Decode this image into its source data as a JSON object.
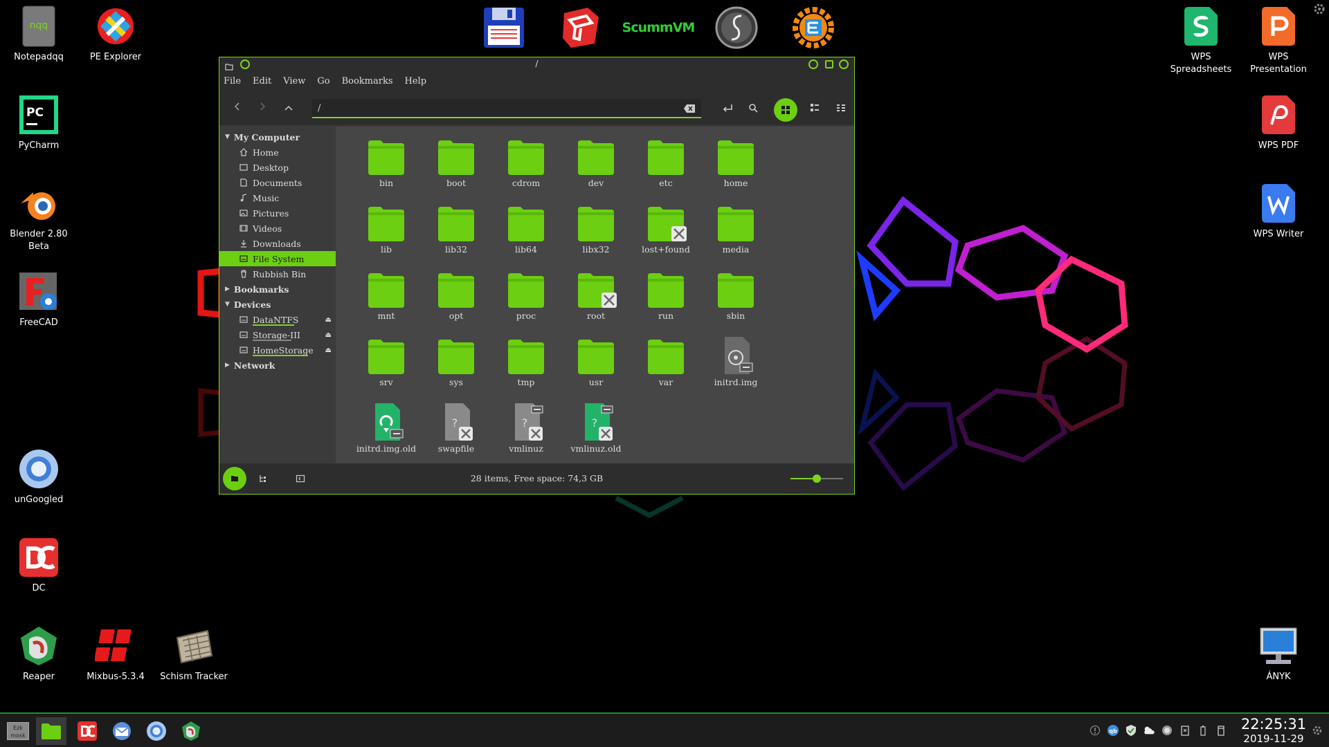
{
  "desktop": {
    "left_icons": [
      {
        "label": "Notepadqq"
      },
      {
        "label": "PE Explorer"
      },
      {
        "label": "PyCharm"
      },
      {
        "label": "Blender 2.80 Beta"
      },
      {
        "label": "FreeCAD"
      },
      {
        "label": "unGoogled"
      },
      {
        "label": "DC"
      },
      {
        "label": "Reaper"
      },
      {
        "label": "Mixbus-5.3.4"
      },
      {
        "label": "Schism Tracker"
      }
    ],
    "right_icons": [
      {
        "label": "WPS Spreadsheets"
      },
      {
        "label": "WPS Presentation"
      },
      {
        "label": "WPS PDF"
      },
      {
        "label": "WPS Writer"
      },
      {
        "label": "ÁNYK"
      }
    ],
    "top_dock": [
      {
        "name": "floppy-save-icon"
      },
      {
        "name": "sketchup-icon"
      },
      {
        "name": "scummvm-icon"
      },
      {
        "name": "script-s-icon"
      },
      {
        "name": "gear-e-icon"
      }
    ],
    "scummvm_text": "ScummVM",
    "notepadqq_badge": "nqq",
    "pycharm_badge": "PC"
  },
  "window": {
    "title": "/",
    "menu": [
      "File",
      "Edit",
      "View",
      "Go",
      "Bookmarks",
      "Help"
    ],
    "path_value": "/",
    "sidebar": {
      "my_computer": "My Computer",
      "places": [
        "Home",
        "Desktop",
        "Documents",
        "Music",
        "Pictures",
        "Videos",
        "Downloads",
        "File System",
        "Rubbish Bin"
      ],
      "bookmarks": "Bookmarks",
      "devices": "Devices",
      "device_items": [
        "DataNTFS",
        "Storage-III",
        "HomeStorage"
      ],
      "network": "Network"
    },
    "files": [
      {
        "name": "bin"
      },
      {
        "name": "boot"
      },
      {
        "name": "cdrom"
      },
      {
        "name": "dev"
      },
      {
        "name": "etc"
      },
      {
        "name": "home"
      },
      {
        "name": "lib"
      },
      {
        "name": "lib32"
      },
      {
        "name": "lib64"
      },
      {
        "name": "libx32"
      },
      {
        "name": "lost+found"
      },
      {
        "name": "media"
      },
      {
        "name": "mnt"
      },
      {
        "name": "opt"
      },
      {
        "name": "proc"
      },
      {
        "name": "root"
      },
      {
        "name": "run"
      },
      {
        "name": "sbin"
      },
      {
        "name": "srv"
      },
      {
        "name": "sys"
      },
      {
        "name": "tmp"
      },
      {
        "name": "usr"
      },
      {
        "name": "var"
      },
      {
        "name": "initrd.img"
      },
      {
        "name": "initrd.img.old"
      },
      {
        "name": "swapfile"
      },
      {
        "name": "vmlinuz"
      },
      {
        "name": "vmlinuz.old"
      }
    ],
    "status": "28 items,  Free space: 74,3 GB",
    "zoom_level": 0.5
  },
  "taskbar": {
    "time": "22:25:31",
    "date": "2019-11-29",
    "show_desktop_label": "Ezk mosk"
  },
  "colors": {
    "accent": "#6ccf12",
    "folder": "#6ccf12",
    "window_bg": "#3b3b3b",
    "files_bg": "#464646"
  }
}
